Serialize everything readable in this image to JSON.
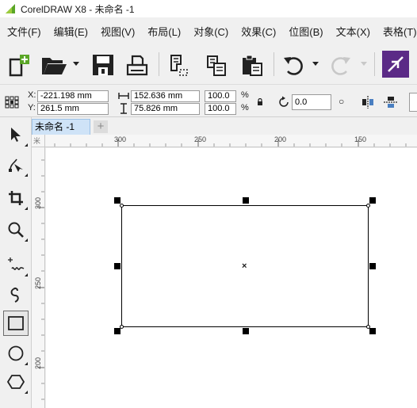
{
  "window": {
    "title": "CorelDRAW X8 - 未命名 -1"
  },
  "menu": {
    "items": [
      {
        "label": "文件(F)"
      },
      {
        "label": "编辑(E)"
      },
      {
        "label": "视图(V)"
      },
      {
        "label": "布局(L)"
      },
      {
        "label": "对象(C)"
      },
      {
        "label": "效果(C)"
      },
      {
        "label": "位图(B)"
      },
      {
        "label": "文本(X)"
      },
      {
        "label": "表格(T)"
      }
    ]
  },
  "propbar": {
    "x_label": "X:",
    "x_value": "-221.198 mm",
    "y_label": "Y:",
    "y_value": "261.5 mm",
    "width_value": "152.636 mm",
    "height_value": "75.826 mm",
    "scale_x": "100.0",
    "scale_y": "100.0",
    "percent_1": "%",
    "percent_2": "%",
    "rotation_value": "0.0",
    "degree_symbol": "○"
  },
  "document": {
    "tab_label": "未命名 -1",
    "new_tab_label": "+"
  },
  "rulers": {
    "horizontal": [
      "300",
      "250",
      "200",
      "150"
    ],
    "vertical": [
      "300",
      "250",
      "200"
    ],
    "corner": "米"
  },
  "canvas": {
    "center_marker": "×"
  },
  "colors": {
    "accent_green": "#5aa627",
    "tab_blue": "#cfe3f7",
    "transform_purple": "#5b2a86"
  }
}
